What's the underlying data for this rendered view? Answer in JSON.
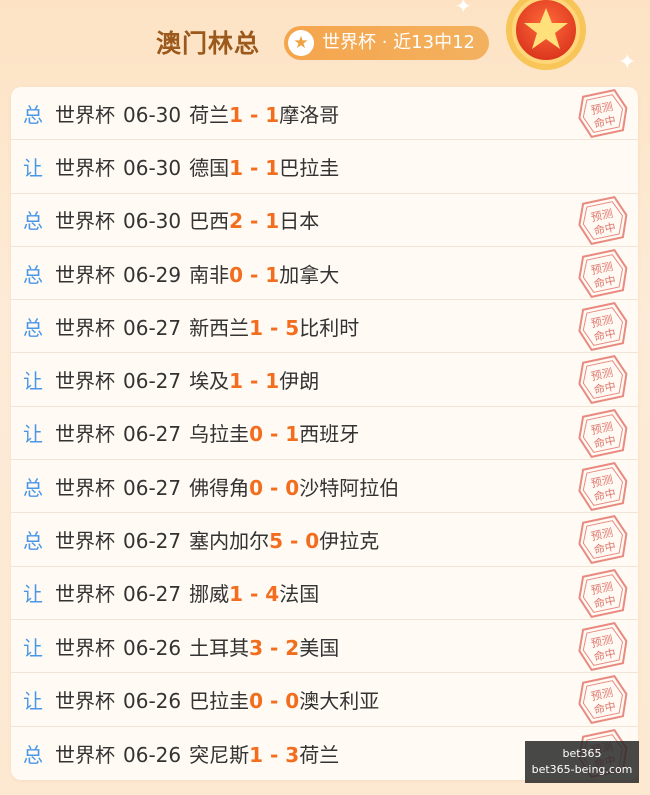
{
  "header": {
    "title": "澳门林总",
    "badge_icon": "star-icon",
    "badge_text": "世界杯 · 近13中12",
    "medal_icon": "trophy-star-medal-icon"
  },
  "stamp_text": [
    "预测",
    "命中"
  ],
  "rows": [
    {
      "type": "总",
      "league": "世界杯",
      "date": "06-30",
      "home": "荷兰",
      "home_score": "1",
      "away_score": "1",
      "away": "摩洛哥",
      "hit": true
    },
    {
      "type": "让",
      "league": "世界杯",
      "date": "06-30",
      "home": "德国",
      "home_score": "1",
      "away_score": "1",
      "away": "巴拉圭",
      "hit": false
    },
    {
      "type": "总",
      "league": "世界杯",
      "date": "06-30",
      "home": "巴西",
      "home_score": "2",
      "away_score": "1",
      "away": "日本",
      "hit": true
    },
    {
      "type": "总",
      "league": "世界杯",
      "date": "06-29",
      "home": "南非",
      "home_score": "0",
      "away_score": "1",
      "away": "加拿大",
      "hit": true
    },
    {
      "type": "总",
      "league": "世界杯",
      "date": "06-27",
      "home": "新西兰",
      "home_score": "1",
      "away_score": "5",
      "away": "比利时",
      "hit": true
    },
    {
      "type": "让",
      "league": "世界杯",
      "date": "06-27",
      "home": "埃及",
      "home_score": "1",
      "away_score": "1",
      "away": "伊朗",
      "hit": true
    },
    {
      "type": "让",
      "league": "世界杯",
      "date": "06-27",
      "home": "乌拉圭",
      "home_score": "0",
      "away_score": "1",
      "away": "西班牙",
      "hit": true
    },
    {
      "type": "总",
      "league": "世界杯",
      "date": "06-27",
      "home": "佛得角",
      "home_score": "0",
      "away_score": "0",
      "away": "沙特阿拉伯",
      "hit": true
    },
    {
      "type": "总",
      "league": "世界杯",
      "date": "06-27",
      "home": "塞内加尔",
      "home_score": "5",
      "away_score": "0",
      "away": "伊拉克",
      "hit": true
    },
    {
      "type": "让",
      "league": "世界杯",
      "date": "06-27",
      "home": "挪威",
      "home_score": "1",
      "away_score": "4",
      "away": "法国",
      "hit": true
    },
    {
      "type": "让",
      "league": "世界杯",
      "date": "06-26",
      "home": "土耳其",
      "home_score": "3",
      "away_score": "2",
      "away": "美国",
      "hit": true
    },
    {
      "type": "让",
      "league": "世界杯",
      "date": "06-26",
      "home": "巴拉圭",
      "home_score": "0",
      "away_score": "0",
      "away": "澳大利亚",
      "hit": true
    },
    {
      "type": "总",
      "league": "世界杯",
      "date": "06-26",
      "home": "突尼斯",
      "home_score": "1",
      "away_score": "3",
      "away": "荷兰",
      "hit": true
    }
  ],
  "watermark": {
    "line1": "bet365",
    "line2": "bet365-being.com"
  }
}
